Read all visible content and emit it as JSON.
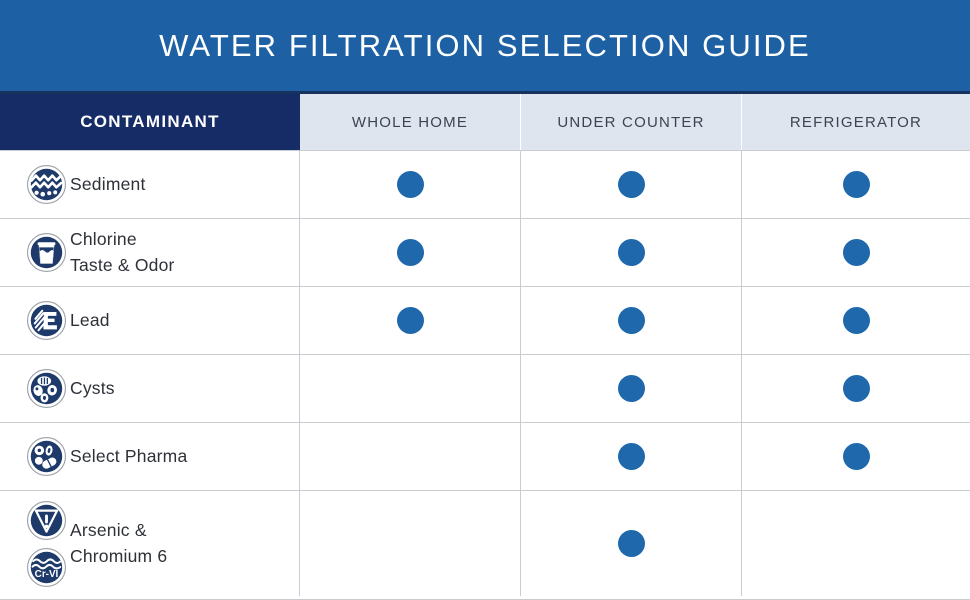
{
  "banner": {
    "title": "WATER FILTRATION SELECTION GUIDE"
  },
  "table": {
    "headers": {
      "contaminant": "CONTAMINANT",
      "columns": [
        "WHOLE HOME",
        "UNDER COUNTER",
        "REFRIGERATOR"
      ]
    },
    "rows": [
      {
        "label": "Sediment",
        "label_line2": "",
        "icons": [
          "sediment-waves-icon"
        ],
        "marks": [
          true,
          true,
          true
        ]
      },
      {
        "label": "Chlorine",
        "label_line2": "Taste & Odor",
        "icons": [
          "water-glass-icon"
        ],
        "marks": [
          true,
          true,
          true
        ]
      },
      {
        "label": "Lead",
        "label_line2": "",
        "icons": [
          "lead-plates-icon"
        ],
        "marks": [
          true,
          true,
          true
        ]
      },
      {
        "label": "Cysts",
        "label_line2": "",
        "icons": [
          "cysts-microbe-icon"
        ],
        "marks": [
          false,
          true,
          true
        ]
      },
      {
        "label": "Select Pharma",
        "label_line2": "",
        "icons": [
          "pills-capsule-icon"
        ],
        "marks": [
          false,
          true,
          true
        ]
      },
      {
        "label": "Arsenic &",
        "label_line2": "Chromium 6",
        "icons": [
          "hazard-triangle-icon",
          "chromium-six-icon"
        ],
        "marks": [
          false,
          true,
          false
        ]
      }
    ]
  },
  "icon_text": {
    "chromium_six": "Cr-VI"
  },
  "colors": {
    "banner_blue": "#1d61a4",
    "header_navy": "#152c66",
    "header_light": "#dfe5ee",
    "dot_blue": "#1f68ab",
    "icon_navy": "#1d3a6b",
    "grid_line": "#c9ccd1",
    "text_dark": "#2e3138"
  }
}
